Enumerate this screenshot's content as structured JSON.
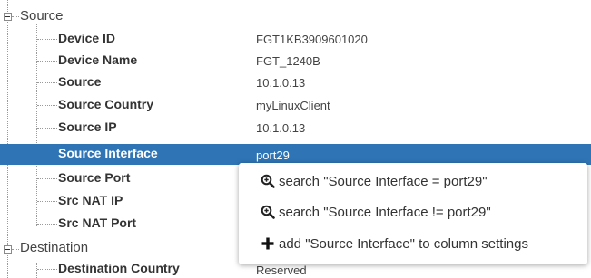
{
  "tree": {
    "source_group": {
      "label": "Source"
    },
    "destination_group": {
      "label": "Destination"
    },
    "rows": [
      {
        "key": "Device ID",
        "value": "FGT1KB3909601020"
      },
      {
        "key": "Device Name",
        "value": "FGT_1240B"
      },
      {
        "key": "Source",
        "value": "10.1.0.13"
      },
      {
        "key": "Source Country",
        "value": "myLinuxClient"
      },
      {
        "key": "Source IP",
        "value": "10.1.0.13"
      },
      {
        "key": "Source Interface",
        "value": "port29"
      },
      {
        "key": "Source Port",
        "value": ""
      },
      {
        "key": "Src NAT IP",
        "value": ""
      },
      {
        "key": "Src NAT Port",
        "value": ""
      }
    ],
    "destination_rows": [
      {
        "key": "Destination Country",
        "value": "Reserved"
      }
    ]
  },
  "context_menu": {
    "items": [
      {
        "label": "search \"Source Interface = port29\"",
        "icon": "zoom-in-icon"
      },
      {
        "label": "search \"Source Interface != port29\"",
        "icon": "zoom-in-icon"
      },
      {
        "label": "add \"Source Interface\" to column settings",
        "icon": "plus-icon"
      }
    ]
  },
  "colors": {
    "selection": "#2f75b5",
    "text": "#333333"
  }
}
